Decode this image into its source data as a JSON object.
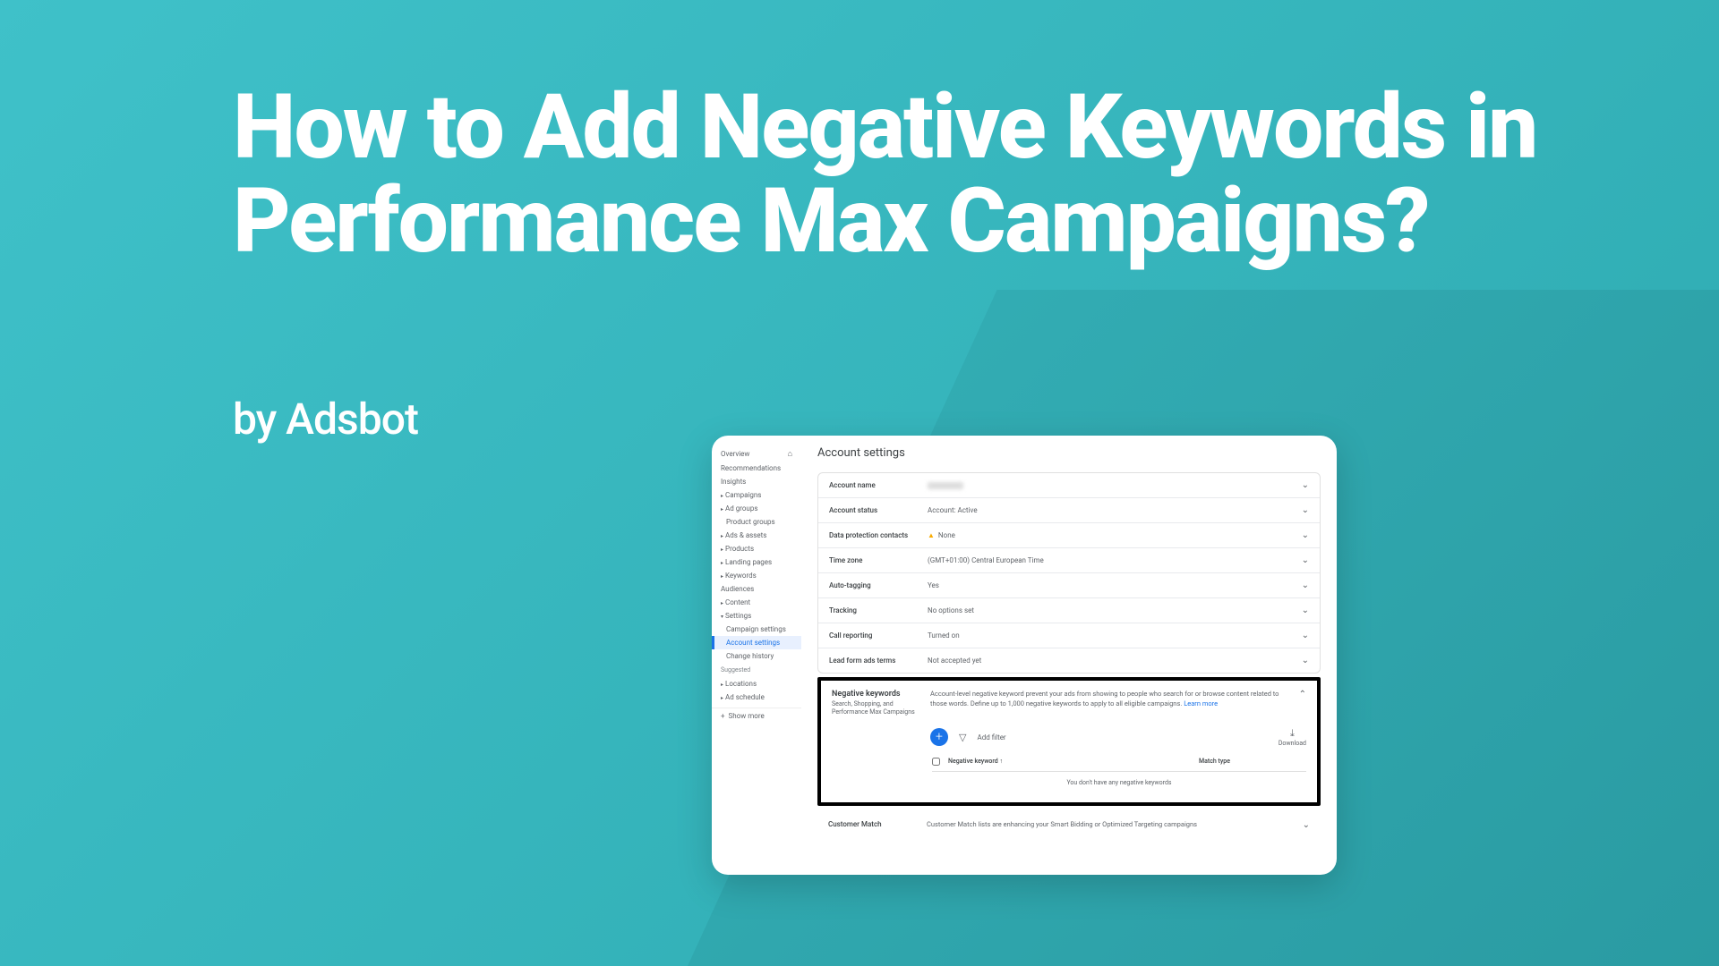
{
  "title": "How to Add Negative Keywords in Performance Max Campaigns?",
  "byline": "by Adsbot",
  "sidebar": {
    "overview": "Overview",
    "recommendations": "Recommendations",
    "insights": "Insights",
    "campaigns": "Campaigns",
    "adgroups": "Ad groups",
    "productgroups": "Product groups",
    "adsassets": "Ads & assets",
    "products": "Products",
    "landingpages": "Landing pages",
    "keywords": "Keywords",
    "audiences": "Audiences",
    "content": "Content",
    "settings": "Settings",
    "campaignsettings": "Campaign settings",
    "accountsettings": "Account settings",
    "changehistory": "Change history",
    "suggested": "Suggested",
    "locations": "Locations",
    "adschedule": "Ad schedule",
    "showmore": "Show more"
  },
  "page": {
    "heading": "Account settings"
  },
  "rows": {
    "accountname": {
      "label": "Account name",
      "value": ""
    },
    "accountstatus": {
      "label": "Account status",
      "value": "Account: Active"
    },
    "dataprotection": {
      "label": "Data protection contacts",
      "value": "None"
    },
    "timezone": {
      "label": "Time zone",
      "value": "(GMT+01:00) Central European Time"
    },
    "autotagging": {
      "label": "Auto-tagging",
      "value": "Yes"
    },
    "tracking": {
      "label": "Tracking",
      "value": "No options set"
    },
    "callreporting": {
      "label": "Call reporting",
      "value": "Turned on"
    },
    "leadform": {
      "label": "Lead form ads terms",
      "value": "Not accepted yet"
    }
  },
  "negative": {
    "title": "Negative keywords",
    "subtitle": "Search, Shopping, and Performance Max Campaigns",
    "description": "Account-level negative keyword prevent your ads from showing to people who search for or browse content related to those words. Define up to 1,000 negative keywords to apply to all eligible campaigns.",
    "learnmore": "Learn more",
    "addfilter": "Add filter",
    "download": "Download",
    "col_keyword": "Negative keyword",
    "col_matchtype": "Match type",
    "empty": "You don't have any negative keywords"
  },
  "customermatch": {
    "label": "Customer Match",
    "desc": "Customer Match lists are enhancing your Smart Bidding or Optimized Targeting campaigns"
  }
}
